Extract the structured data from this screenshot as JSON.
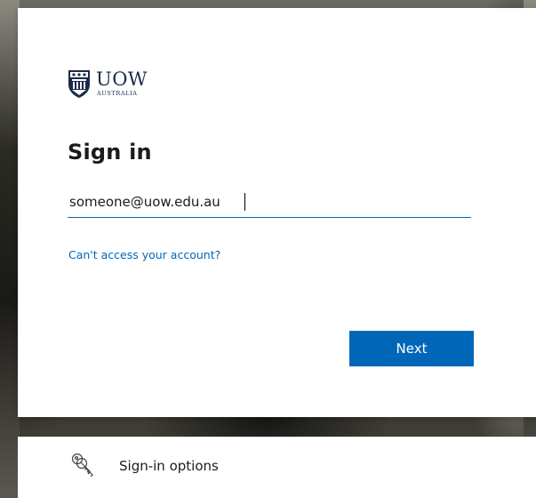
{
  "brand": {
    "name": "UOW",
    "subtitle": "AUSTRALIA",
    "logo_icon": "uow-crest-icon"
  },
  "signin": {
    "title": "Sign in",
    "email_value": "someone@uow.edu.au",
    "cant_access_link": "Can't access your account?",
    "next_label": "Next"
  },
  "options": {
    "label": "Sign-in options",
    "icon": "key-icon"
  },
  "colors": {
    "accent": "#0067b8",
    "text": "#1b1b1b",
    "brand_navy": "#1b2a4a"
  }
}
